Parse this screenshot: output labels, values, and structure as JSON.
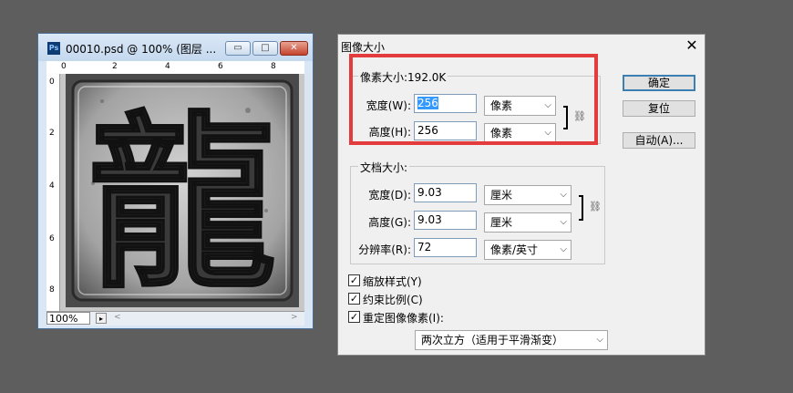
{
  "document_window": {
    "app_icon": "ps-icon",
    "icon_text": "Ps",
    "title": "00010.psd @ 100% (图层 ...",
    "controls": {
      "minimize": "▭",
      "maximize": "□",
      "close": "✕"
    },
    "ruler_h": [
      "0",
      "2",
      "4",
      "6",
      "8"
    ],
    "ruler_v": [
      "0",
      "2",
      "4",
      "6",
      "8"
    ],
    "image_text": "龍",
    "zoom": "100%"
  },
  "dialog": {
    "title": "图像大小",
    "close": "✕",
    "pixel_dimensions": {
      "label": "像素大小:192.0K",
      "width_label": "宽度(W):",
      "width_value": "256",
      "width_unit": "像素",
      "height_label": "高度(H):",
      "height_value": "256",
      "height_unit": "像素"
    },
    "document_size": {
      "label": "文档大小:",
      "width_label": "宽度(D):",
      "width_value": "9.03",
      "width_unit": "厘米",
      "height_label": "高度(G):",
      "height_value": "9.03",
      "height_unit": "厘米",
      "resolution_label": "分辨率(R):",
      "resolution_value": "72",
      "resolution_unit": "像素/英寸"
    },
    "buttons": {
      "ok": "确定",
      "reset": "复位",
      "auto": "自动(A)..."
    },
    "options": {
      "scale_styles": "缩放样式(Y)",
      "constrain": "约束比例(C)",
      "resample": "重定图像像素(I):"
    },
    "resample_method": "两次立方（适用于平滑渐变）"
  },
  "colors": {
    "highlight": "#e43c3c",
    "selection": "#3399ff"
  }
}
